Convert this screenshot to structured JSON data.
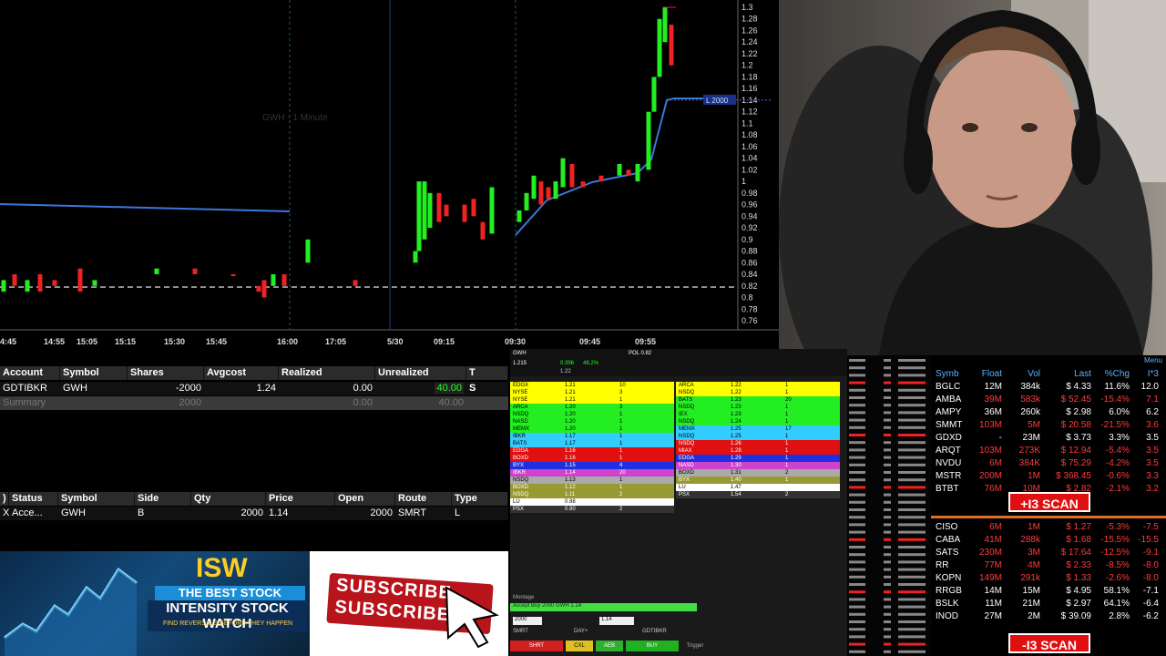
{
  "chart": {
    "watermark": "GWH - 1 Minute",
    "price_ticks": [
      "1.3",
      "1.28",
      "1.26",
      "1.24",
      "1.22",
      "1.2",
      "1.18",
      "1.16",
      "1.14",
      "1.12",
      "1.1",
      "1.08",
      "1.06",
      "1.04",
      "1.02",
      "1",
      "0.98",
      "0.96",
      "0.94",
      "0.92",
      "0.9",
      "0.88",
      "0.86",
      "0.84",
      "0.82",
      "0.8",
      "0.78",
      "0.76"
    ],
    "time_ticks": [
      "4:45",
      "14:55",
      "15:05",
      "15:15",
      "15:30",
      "15:45",
      "16:00",
      "17:05",
      "5/30",
      "09:15",
      "09:30",
      "09:45",
      "09:55"
    ],
    "position_tag": "L 2000",
    "position_price": "1.14"
  },
  "chart_data": {
    "type": "candlestick",
    "title": "GWH - 1 Minute",
    "ylim": [
      0.76,
      1.3
    ],
    "x": [
      "4:45",
      "14:55",
      "15:05",
      "15:15",
      "15:30",
      "15:45",
      "16:00",
      "17:05",
      "5/30",
      "09:15",
      "09:30",
      "09:45",
      "09:55"
    ],
    "series": [
      {
        "name": "price",
        "values": [
          0.82,
          0.83,
          0.82,
          0.81,
          0.82,
          0.83,
          0.82,
          0.84,
          0.82,
          0.9,
          0.95,
          0.96,
          0.98,
          1.0,
          1.02,
          1.04,
          1.14,
          1.3
        ]
      }
    ]
  },
  "portfolio": {
    "headers": [
      "Account",
      "Symbol",
      "Shares",
      "Avgcost",
      "Realized",
      "Unrealized",
      "T"
    ],
    "row": [
      "GDTIBKR",
      "GWH",
      "-2000",
      "1.24",
      "0.00",
      "40.00",
      "S"
    ],
    "summary": [
      "Summary",
      "",
      "2000",
      "",
      "0.00",
      "40.00",
      ""
    ]
  },
  "orders": {
    "headers": [
      ")",
      "Status",
      "Symbol",
      "Side",
      "Qty",
      "Price",
      "Open",
      "Route",
      "Type"
    ],
    "row": [
      "X",
      "Acce...",
      "GWH",
      "B",
      "2000",
      "1.14",
      "2000",
      "SMRT",
      "L"
    ]
  },
  "banner_isw": {
    "logo": "ISW",
    "tagline": "THE BEST STOCK SCANNER",
    "title": "INTENSITY STOCK WATCH",
    "sub": "FIND REVERSALS BEFORE THEY HAPPEN"
  },
  "banner_sub": {
    "text1": "SUBSCRIBE",
    "text2": "SUBSCRIBE"
  },
  "level2": {
    "symbol": "GWH",
    "last": "1.215",
    "pos": "POL 0.82",
    "bid": "1.22",
    "change": "0.396",
    "pct": "48.2%",
    "order_line": "Accept Buy 2000 GWH 1.14",
    "qty": "2000",
    "price": "1.14",
    "route": "SMRT",
    "tif": "DAY+",
    "account": "GDTIBKR",
    "buttons": [
      "SHRT",
      "CXL",
      "AEB",
      "BUY"
    ],
    "trigger": "Trigger",
    "montage": "Montage",
    "bids": [
      {
        "mm": "EDGX",
        "px": "1.21",
        "sz": "10",
        "c": "#ffff00"
      },
      {
        "mm": "NYSE",
        "px": "1.21",
        "sz": "3",
        "c": "#ffff00"
      },
      {
        "mm": "NYSE",
        "px": "1.21",
        "sz": "1",
        "c": "#ffff00"
      },
      {
        "mm": "ARCA",
        "px": "1.20",
        "sz": "3",
        "c": "#22ee22"
      },
      {
        "mm": "NSDQ",
        "px": "1.20",
        "sz": "1",
        "c": "#22ee22"
      },
      {
        "mm": "NASD",
        "px": "1.20",
        "sz": "1",
        "c": "#22ee22"
      },
      {
        "mm": "MEMX",
        "px": "1.20",
        "sz": "1",
        "c": "#22ee22"
      },
      {
        "mm": "IBKR",
        "px": "1.17",
        "sz": "1",
        "c": "#33ccff"
      },
      {
        "mm": "BATS",
        "px": "1.17",
        "sz": "1",
        "c": "#33ccff"
      },
      {
        "mm": "EDGA",
        "px": "1.16",
        "sz": "1",
        "c": "#e01010"
      },
      {
        "mm": "BOXD",
        "px": "1.16",
        "sz": "1",
        "c": "#e01010"
      },
      {
        "mm": "BYX",
        "px": "1.15",
        "sz": "4",
        "c": "#2030e0"
      },
      {
        "mm": "IBKR",
        "px": "1.14",
        "sz": "20",
        "c": "#cc44cc"
      },
      {
        "mm": "NSDQ",
        "px": "1.13",
        "sz": "1",
        "c": "#aaaaaa"
      },
      {
        "mm": "BOXD",
        "px": "1.12",
        "sz": "1",
        "c": "#999933"
      },
      {
        "mm": "NSDQ",
        "px": "1.11",
        "sz": "2",
        "c": "#999933"
      },
      {
        "mm": "LU",
        "px": "0.98",
        "sz": "",
        "c": "#ffffff"
      },
      {
        "mm": "PSX",
        "px": "0.90",
        "sz": "2",
        "c": "#333333"
      }
    ],
    "asks": [
      {
        "mm": "ARCA",
        "px": "1.22",
        "sz": "1",
        "c": "#ffff00"
      },
      {
        "mm": "NSDQ",
        "px": "1.22",
        "sz": "1",
        "c": "#ffff00"
      },
      {
        "mm": "BATS",
        "px": "1.23",
        "sz": "20",
        "c": "#22ee22"
      },
      {
        "mm": "NSDQ",
        "px": "1.23",
        "sz": "1",
        "c": "#22ee22"
      },
      {
        "mm": "IEX",
        "px": "1.23",
        "sz": "1",
        "c": "#22ee22"
      },
      {
        "mm": "NSDQ",
        "px": "1.24",
        "sz": "1",
        "c": "#22ee22"
      },
      {
        "mm": "MEMX",
        "px": "1.25",
        "sz": "17",
        "c": "#33ccff"
      },
      {
        "mm": "NSDQ",
        "px": "1.25",
        "sz": "1",
        "c": "#33ccff"
      },
      {
        "mm": "NSDQ",
        "px": "1.26",
        "sz": "1",
        "c": "#e01010"
      },
      {
        "mm": "MIAX",
        "px": "1.28",
        "sz": "1",
        "c": "#e01010"
      },
      {
        "mm": "EDGA",
        "px": "1.29",
        "sz": "1",
        "c": "#2030e0"
      },
      {
        "mm": "NASD",
        "px": "1.30",
        "sz": "1",
        "c": "#cc44cc"
      },
      {
        "mm": "BOXD",
        "px": "1.31",
        "sz": "2",
        "c": "#aaaaaa"
      },
      {
        "mm": "BYX",
        "px": "1.40",
        "sz": "1",
        "c": "#999933"
      },
      {
        "mm": "LU",
        "px": "1.47",
        "sz": "",
        "c": "#ffffff"
      },
      {
        "mm": "PSX",
        "px": "1.54",
        "sz": "2",
        "c": "#333333"
      }
    ]
  },
  "scanner": {
    "headers": [
      "Symb",
      "Float",
      "Vol",
      "Last",
      "%Chg",
      "I*3"
    ],
    "menu": "Menu",
    "top": [
      {
        "s": "BGLC",
        "f": "12M",
        "v": "384k",
        "l": "$ 4.33",
        "p": "11.6%",
        "m": "12.0",
        "c": "#ffffff"
      },
      {
        "s": "AMBA",
        "f": "39M",
        "v": "583k",
        "l": "$ 52.45",
        "p": "-15.4%",
        "m": "7.1",
        "c": "#ff3b3b"
      },
      {
        "s": "AMPY",
        "f": "36M",
        "v": "260k",
        "l": "$ 2.98",
        "p": "6.0%",
        "m": "6.2",
        "c": "#ffffff"
      },
      {
        "s": "SMMT",
        "f": "103M",
        "v": "5M",
        "l": "$ 20.58",
        "p": "-21.5%",
        "m": "3.6",
        "c": "#ff3b3b"
      },
      {
        "s": "GDXD",
        "f": "-",
        "v": "23M",
        "l": "$ 3.73",
        "p": "3.3%",
        "m": "3.5",
        "c": "#ffffff"
      },
      {
        "s": "ARQT",
        "f": "103M",
        "v": "273K",
        "l": "$ 12.94",
        "p": "-5.4%",
        "m": "3.5",
        "c": "#ff3b3b"
      },
      {
        "s": "NVDU",
        "f": "6M",
        "v": "384K",
        "l": "$ 75.29",
        "p": "-4.2%",
        "m": "3.5",
        "c": "#ff3b3b"
      },
      {
        "s": "MSTR",
        "f": "200M",
        "v": "1M",
        "l": "$ 368.45",
        "p": "-0.6%",
        "m": "3.3",
        "c": "#ff3b3b"
      },
      {
        "s": "BTBT",
        "f": "76M",
        "v": "10M",
        "l": "$ 2.82",
        "p": "-2.1%",
        "m": "3.2",
        "c": "#ff3b3b"
      }
    ],
    "plus_label": "+I3 SCAN",
    "bottom": [
      {
        "s": "CISO",
        "f": "6M",
        "v": "1M",
        "l": "$ 1.27",
        "p": "-5.3%",
        "m": "-7.5",
        "c": "#ff3b3b"
      },
      {
        "s": "CABA",
        "f": "41M",
        "v": "288k",
        "l": "$ 1.68",
        "p": "-15.5%",
        "m": "-15.5",
        "c": "#ff3b3b"
      },
      {
        "s": "SATS",
        "f": "230M",
        "v": "3M",
        "l": "$ 17.64",
        "p": "-12.5%",
        "m": "-9.1",
        "c": "#ff3b3b"
      },
      {
        "s": "RR",
        "f": "77M",
        "v": "4M",
        "l": "$ 2.33",
        "p": "-8.5%",
        "m": "-8.0",
        "c": "#ff3b3b"
      },
      {
        "s": "KOPN",
        "f": "149M",
        "v": "291k",
        "l": "$ 1.33",
        "p": "-2.6%",
        "m": "-8.0",
        "c": "#ff3b3b"
      },
      {
        "s": "RRGB",
        "f": "14M",
        "v": "15M",
        "l": "$ 4.95",
        "p": "58.1%",
        "m": "-7.1",
        "c": "#ffffff"
      },
      {
        "s": "BSLK",
        "f": "11M",
        "v": "21M",
        "l": "$ 2.97",
        "p": "64.1%",
        "m": "-6.4",
        "c": "#ffffff"
      },
      {
        "s": "INOD",
        "f": "27M",
        "v": "2M",
        "l": "$ 39.09",
        "p": "2.8%",
        "m": "-6.2",
        "c": "#ffffff"
      }
    ],
    "minus_label": "-I3 SCAN"
  }
}
